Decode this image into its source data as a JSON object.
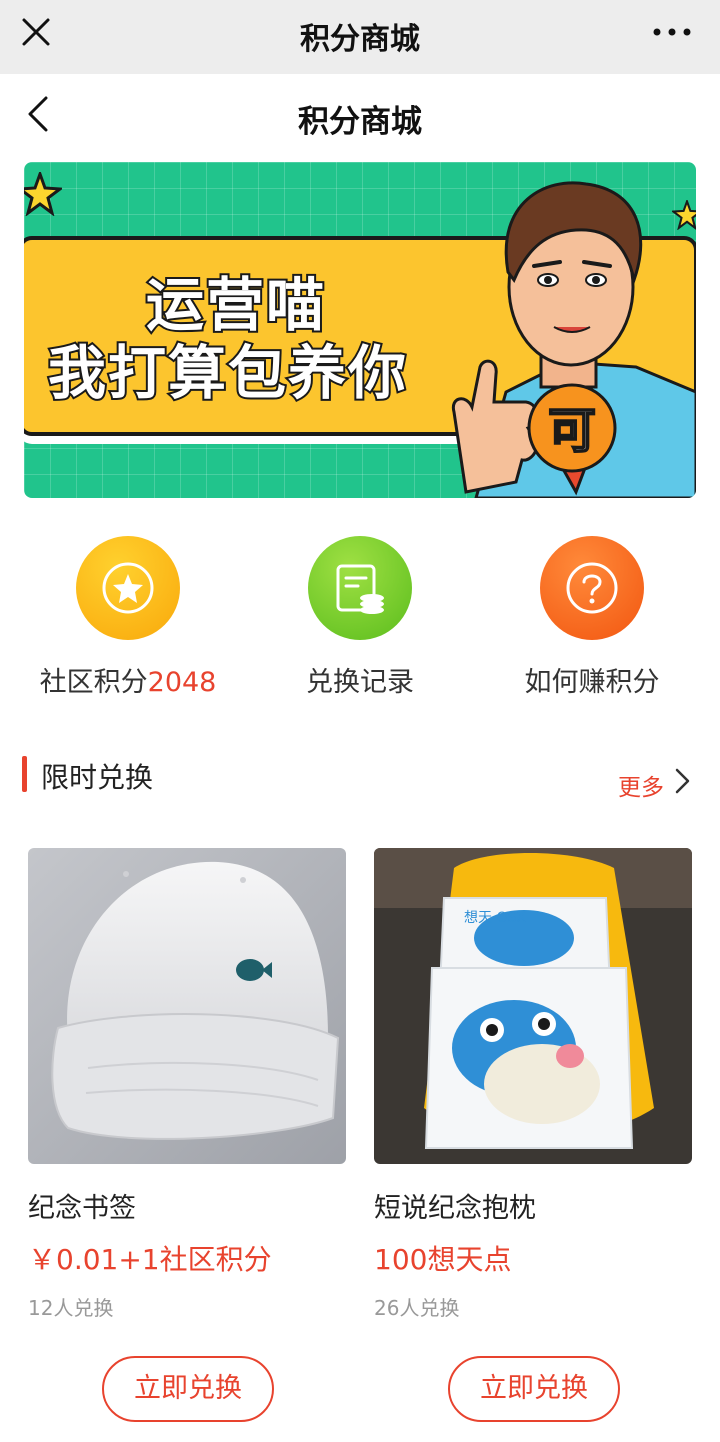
{
  "topbar": {
    "title": "积分商城"
  },
  "header": {
    "title": "积分商城"
  },
  "banner": {
    "line1": "运营喵",
    "line2": "我打算包养你",
    "badge": "可"
  },
  "quick": {
    "points": {
      "label": "社区积分",
      "value": "2048"
    },
    "records": {
      "label": "兑换记录"
    },
    "earn": {
      "label": "如何赚积分"
    }
  },
  "section": {
    "title": "限时兑换",
    "more": "更多"
  },
  "products": [
    {
      "name": "纪念书签",
      "price": "￥0.01+1社区积分",
      "count": "12人兑换",
      "button": "立即兑换"
    },
    {
      "name": "短说纪念抱枕",
      "price": "100想天点",
      "count": "26人兑换",
      "button": "立即兑换"
    }
  ],
  "colors": {
    "accent": "#e8432e",
    "banner_green": "#21c48c",
    "banner_yellow": "#fcc52e"
  },
  "icons": {
    "close": "close-icon",
    "more": "more-dots-icon",
    "back": "chevron-left-icon",
    "star": "star-icon",
    "coins": "coins-record-icon",
    "help": "question-mark-icon",
    "more_arrow": "chevron-right-icon"
  }
}
